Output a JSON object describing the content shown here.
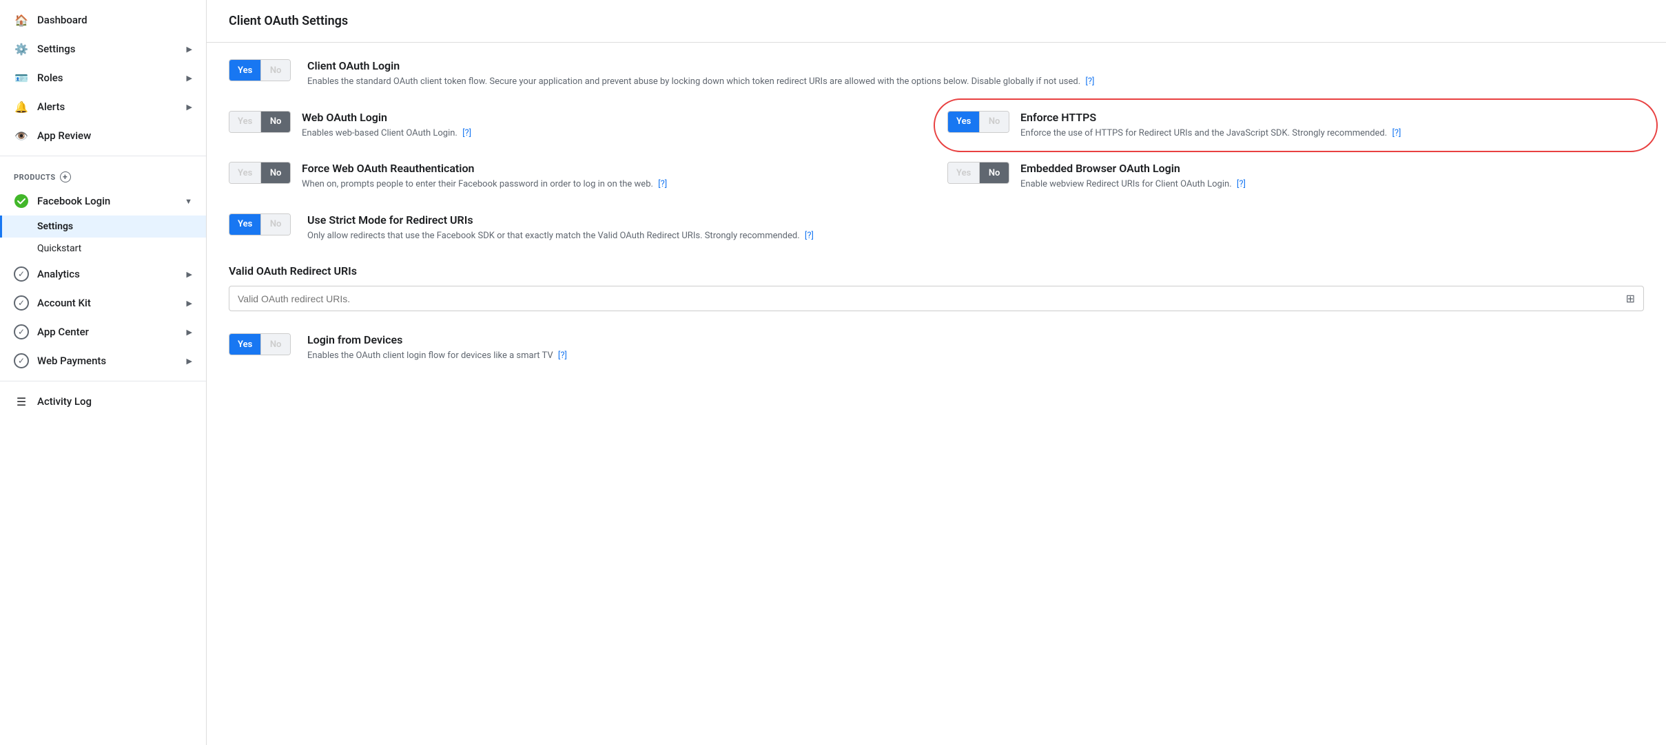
{
  "sidebar": {
    "items": [
      {
        "id": "dashboard",
        "label": "Dashboard",
        "icon": "🏠",
        "hasChevron": false
      },
      {
        "id": "settings",
        "label": "Settings",
        "icon": "⚙️",
        "hasChevron": true
      },
      {
        "id": "roles",
        "label": "Roles",
        "icon": "🪪",
        "hasChevron": true
      },
      {
        "id": "alerts",
        "label": "Alerts",
        "icon": "🔔",
        "hasChevron": true
      },
      {
        "id": "app-review",
        "label": "App Review",
        "icon": "👁️",
        "hasChevron": false
      }
    ],
    "products_header": "PRODUCTS",
    "facebook_login": {
      "label": "Facebook Login",
      "sub_items": [
        {
          "id": "fl-settings",
          "label": "Settings",
          "active": true
        },
        {
          "id": "fl-quickstart",
          "label": "Quickstart",
          "active": false
        }
      ]
    },
    "products": [
      {
        "id": "analytics",
        "label": "Analytics",
        "hasChevron": true
      },
      {
        "id": "account-kit",
        "label": "Account Kit",
        "hasChevron": true
      },
      {
        "id": "app-center",
        "label": "App Center",
        "hasChevron": true
      },
      {
        "id": "web-payments",
        "label": "Web Payments",
        "hasChevron": true
      }
    ],
    "activity_log": "Activity Log"
  },
  "main": {
    "page_title": "Client OAuth Settings",
    "settings": [
      {
        "id": "client-oauth-login",
        "title": "Client OAuth Login",
        "desc": "Enables the standard OAuth client token flow. Secure your application and prevent abuse by locking down which token redirect URIs are allowed with the options below. Disable globally if not used.",
        "help": "[?]",
        "toggle_yes": "Yes",
        "toggle_no": "",
        "active": "yes"
      },
      {
        "id": "web-oauth-login",
        "title": "Web OAuth Login",
        "desc": "Enables web-based Client OAuth Login.",
        "help": "[?]",
        "toggle_yes": "",
        "toggle_no": "No",
        "active": "no"
      },
      {
        "id": "enforce-https",
        "title": "Enforce HTTPS",
        "desc": "Enforce the use of HTTPS for Redirect URIs and the JavaScript SDK. Strongly recommended.",
        "help": "[?]",
        "toggle_yes": "Yes",
        "toggle_no": "",
        "active": "yes",
        "highlighted": true
      },
      {
        "id": "force-web-oauth",
        "title": "Force Web OAuth Reauthentication",
        "desc": "When on, prompts people to enter their Facebook password in order to log in on the web.",
        "help": "[?]",
        "toggle_yes": "",
        "toggle_no": "No",
        "active": "no"
      },
      {
        "id": "embedded-browser",
        "title": "Embedded Browser OAuth Login",
        "desc": "Enable webview Redirect URIs for Client OAuth Login.",
        "help": "[?]",
        "toggle_yes": "",
        "toggle_no": "No",
        "active": "no"
      },
      {
        "id": "strict-mode",
        "title": "Use Strict Mode for Redirect URIs",
        "desc": "Only allow redirects that use the Facebook SDK or that exactly match the Valid OAuth Redirect URIs. Strongly recommended.",
        "help": "[?]",
        "toggle_yes": "Yes",
        "toggle_no": "",
        "active": "yes"
      }
    ],
    "valid_uris": {
      "label": "Valid OAuth Redirect URIs",
      "placeholder": "Valid OAuth redirect URIs."
    },
    "login_from_devices": {
      "title": "Login from Devices",
      "desc": "Enables the OAuth client login flow for devices like a smart TV",
      "help": "[?]",
      "toggle_yes": "Yes",
      "toggle_no": "",
      "active": "yes"
    }
  }
}
